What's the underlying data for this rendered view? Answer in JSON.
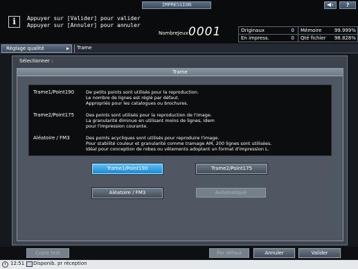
{
  "header": {
    "title": "IMPRESSION",
    "sound_icon": "speaker-icon",
    "help_icon": "question-icon",
    "help_label": "?",
    "info_icon": "info-icon",
    "info_glyph": "i",
    "message_line1": "Appuyer sur [Valider] pour valider",
    "message_line2": "Appuyer sur [Annuler] pour annuler",
    "count_label": "NombreJeux",
    "count_value": "0001"
  },
  "status": {
    "originaux_label": "Originaux",
    "originaux_value": "0",
    "memoire_label": "Mémoire",
    "memoire_value": "99.999%",
    "en_impress_label": "En impress.",
    "en_impress_value": "0",
    "qte_fichier_label": "Qté fichier",
    "qte_fichier_value": "98.828%"
  },
  "breadcrumb": {
    "parent": "Réglage qualité",
    "arrow": "▶",
    "current": "Trame"
  },
  "panel": {
    "select_label": "Sélectionner :",
    "title": "Trame",
    "descriptions": [
      {
        "name": "Trame1/Point190",
        "lines": [
          "De petits points sont utilisés pour la reproduction.",
          "Le nombre de lignes est réglé par défaut.",
          "Appropriés pour les catalogues ou brochures."
        ]
      },
      {
        "name": "Trame2/Point175",
        "lines": [
          "Des points sont utilisés pour la reproduction de l'image.",
          "La granularité diminue en utilisant moins de lignes, idem",
          "pour l'impression courante."
        ]
      },
      {
        "name": "Aléatoire / FM3",
        "lines": [
          "Des points acycliques sont utilisés pour reproduire l'image.",
          "Pour stabilité couleur et granularité comme tramage AM, 200 lignes sont utilisées.",
          "Idéal pour conception de robes ou vêtements adoptant un format d'impression L."
        ]
      }
    ],
    "options": {
      "trame1": "Trame1/Point190",
      "trame2": "Trame2/Point175",
      "aleatoire": "Aléatoire / FM3",
      "automatique": "Automatique"
    },
    "selected_option": "Trame1/Point190"
  },
  "footer": {
    "copy_test": "Copie test",
    "par_defaut": "Par défaut",
    "annuler": "Annuler",
    "valider": "Valider"
  },
  "statusbar": {
    "clock_icon": "clock-icon",
    "time": "12:51",
    "printer_icon": "printer-icon",
    "status_text": "Disponib. pr réception"
  },
  "colors": {
    "selected_button": "#2a96dc",
    "background": "#15191e",
    "panel": "#3d444d"
  }
}
